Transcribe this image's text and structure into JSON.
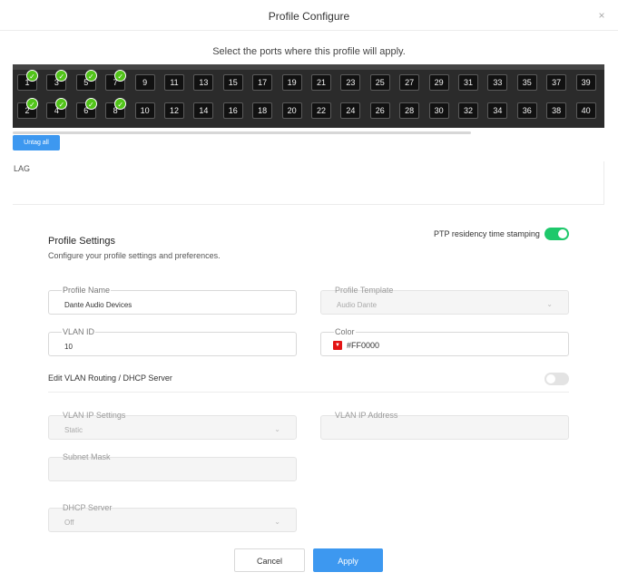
{
  "header": {
    "title": "Profile Configure",
    "close_glyph": "×"
  },
  "ports": {
    "instruction": "Select the ports where this profile will apply.",
    "top_row": [
      "1",
      "3",
      "5",
      "7",
      "9",
      "11",
      "13",
      "15",
      "17",
      "19",
      "21",
      "23",
      "25",
      "27",
      "29",
      "31",
      "33",
      "35",
      "37",
      "39"
    ],
    "bottom_row": [
      "2",
      "4",
      "6",
      "8",
      "10",
      "12",
      "14",
      "16",
      "18",
      "20",
      "22",
      "24",
      "26",
      "28",
      "30",
      "32",
      "34",
      "36",
      "38",
      "40"
    ],
    "selected": [
      "1",
      "2",
      "3",
      "4",
      "5",
      "6",
      "7",
      "8"
    ],
    "untag_label": "Untag all"
  },
  "lag": {
    "label": "LAG"
  },
  "settings": {
    "title": "Profile Settings",
    "subtitle": "Configure your profile settings and preferences.",
    "ptp_label": "PTP residency time stamping",
    "ptp_enabled": true,
    "profile_name": {
      "label": "Profile Name",
      "value": "Dante Audio Devices"
    },
    "profile_template": {
      "label": "Profile Template",
      "value": "Audio Dante"
    },
    "vlan_id": {
      "label": "VLAN ID",
      "value": "10"
    },
    "color": {
      "label": "Color",
      "value": "#FF0000",
      "swatch": "#e31414"
    },
    "routing_label": "Edit VLAN Routing / DHCP Server",
    "routing_enabled": false,
    "vlan_ip_settings": {
      "label": "VLAN IP Settings",
      "value": "Static"
    },
    "vlan_ip_address": {
      "label": "VLAN IP Address",
      "value": ""
    },
    "subnet_mask": {
      "label": "Subnet Mask",
      "value": ""
    },
    "dhcp_server": {
      "label": "DHCP Server",
      "value": "Off"
    }
  },
  "footer": {
    "cancel_label": "Cancel",
    "apply_label": "Apply"
  },
  "colors": {
    "accent": "#3d98f0",
    "toggle_on": "#1ec86b",
    "check": "#52c41a"
  }
}
